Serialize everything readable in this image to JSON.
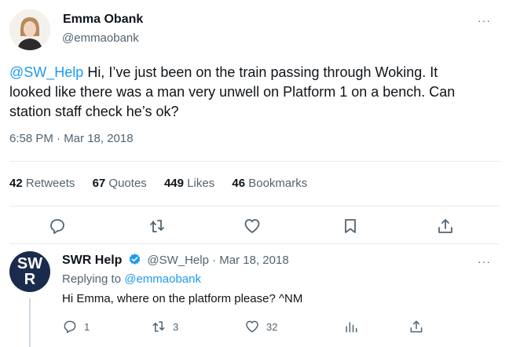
{
  "tweet": {
    "author_name": "Emma Obank",
    "author_handle": "@emmaobank",
    "mention": "@SW_Help",
    "text": " Hi, I’ve just been on the train passing through Woking. It looked like there was a man very unwell on Platform 1 on a bench. Can station staff check he’s ok?",
    "timestamp": "6:58 PM · Mar 18, 2018",
    "more_label": "···",
    "stats": {
      "retweets_count": "42",
      "retweets_label": "Retweets",
      "quotes_count": "67",
      "quotes_label": "Quotes",
      "likes_count": "449",
      "likes_label": "Likes",
      "bookmarks_count": "46",
      "bookmarks_label": "Bookmarks"
    }
  },
  "reply": {
    "avatar_line1": "SW",
    "avatar_line2": "R",
    "author_name": "SWR Help",
    "author_handle": "@SW_Help",
    "date": " · Mar 18, 2018",
    "replying_to_label": "Replying to ",
    "replying_to_handle": "@emmaobank",
    "text": "Hi Emma, where on the platform please? ^NM",
    "more_label": "···",
    "counts": {
      "replies": "1",
      "retweets": "3",
      "likes": "32"
    }
  },
  "colors": {
    "accent": "#1d9bf0",
    "secondary_text": "#536471",
    "verified": "#1d9bf0",
    "swr_navy": "#1a2b4c"
  }
}
